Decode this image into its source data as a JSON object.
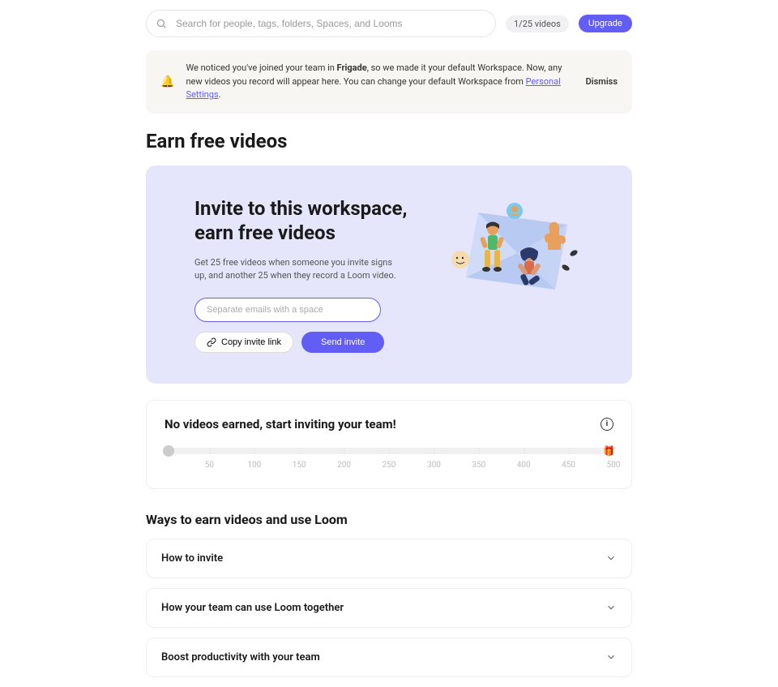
{
  "topbar": {
    "search_placeholder": "Search for people, tags, folders, Spaces, and Looms",
    "video_count": "1/25 videos",
    "upgrade": "Upgrade"
  },
  "notice": {
    "text_a": "We noticed you've joined your team in ",
    "team": "Frigade",
    "text_b": ", so we made it your default Workspace. Now, any new videos you record will appear here. You can change your default Workspace from ",
    "link": "Personal Settings",
    "dismiss": "Dismiss"
  },
  "page_title": "Earn free videos",
  "invite": {
    "title_a": "Invite to this workspace,",
    "title_b": "earn free videos",
    "sub": "Get 25 free videos when someone you invite signs up, and another 25 when they record a Loom video.",
    "email_placeholder": "Separate emails with a space",
    "copy": "Copy invite link",
    "send": "Send invite"
  },
  "progress": {
    "title": "No videos earned, start inviting your team!",
    "ticks": [
      50,
      100,
      150,
      200,
      250,
      300,
      350,
      400,
      450,
      500
    ]
  },
  "ways_title": "Ways to earn videos and use Loom",
  "accordions": [
    {
      "label": "How to invite"
    },
    {
      "label": "How your team can use Loom together"
    },
    {
      "label": "Boost productivity with your team"
    }
  ]
}
